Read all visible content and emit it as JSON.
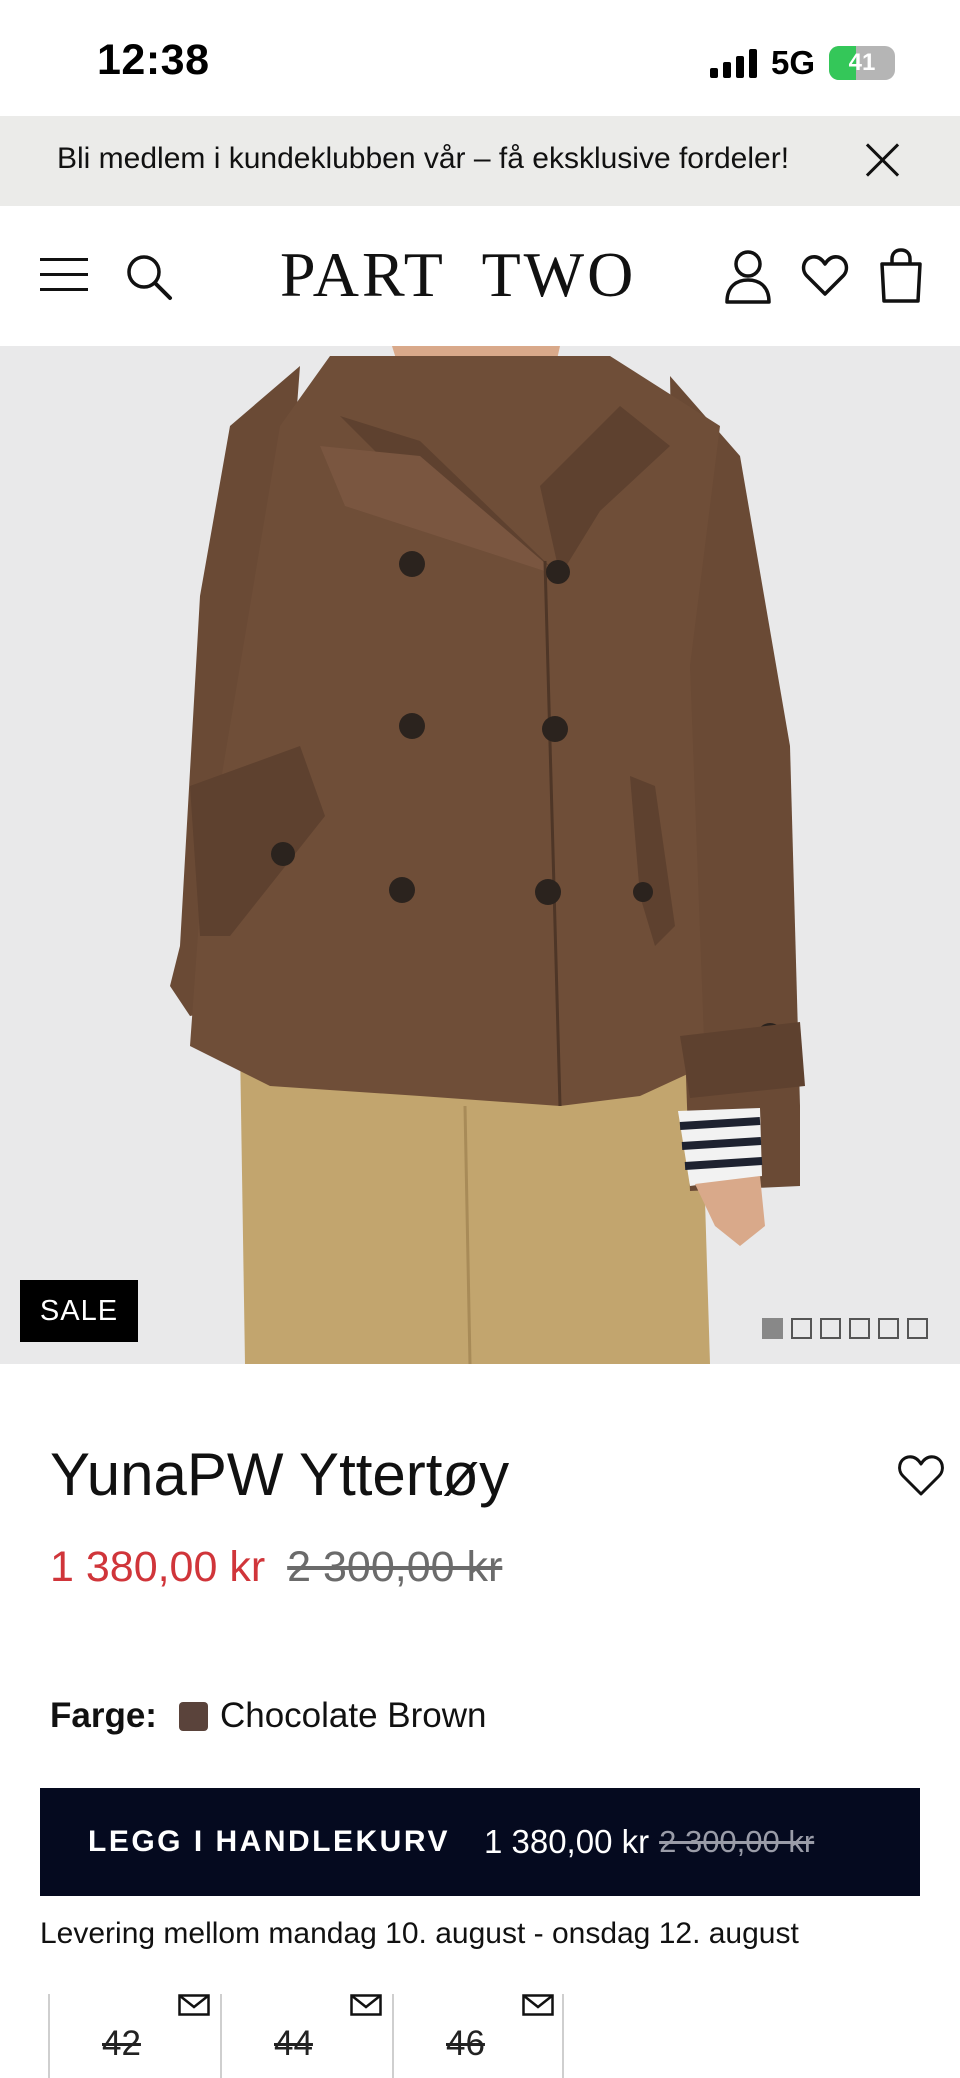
{
  "status_bar": {
    "time": "12:38",
    "network": "5G",
    "battery": "41",
    "battery_level": 0.41
  },
  "promo_banner": {
    "text": "Bli medlem i kundeklubben vår – få eksklusive fordeler!",
    "close_icon": "close-icon"
  },
  "header": {
    "logo": "PART  TWO",
    "icons": [
      "menu-icon",
      "search-icon",
      "account-icon",
      "heart-icon",
      "bag-icon"
    ]
  },
  "product": {
    "badge": "SALE",
    "image_count": 6,
    "active_image": 1,
    "title": "YunaPW Yttertøy",
    "price": "1 380,00 kr",
    "original_price": "2 300,00 kr",
    "price_color": "#d0353a"
  },
  "color": {
    "label": "Farge:",
    "value": "Chocolate Brown",
    "swatch": "#5a433b"
  },
  "cart_button": {
    "label": "LEGG I HANDLEKURV",
    "price": "1 380,00 kr",
    "original_price": "2 300,00 kr",
    "background": "#050a1f"
  },
  "delivery": {
    "text": "Levering mellom mandag 10. august - onsdag 12. august"
  },
  "sizes": [
    {
      "label": "42",
      "available": false
    },
    {
      "label": "44",
      "available": false
    },
    {
      "label": "46",
      "available": false
    }
  ]
}
